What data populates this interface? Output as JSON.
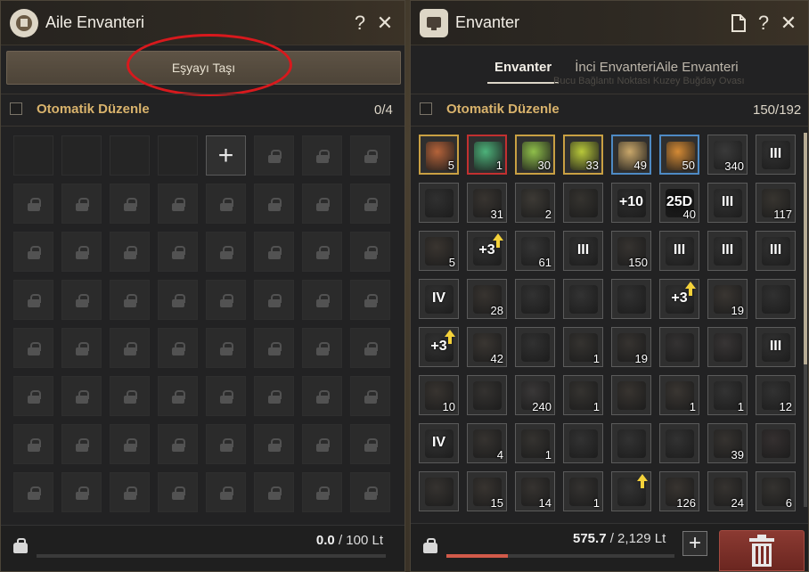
{
  "left": {
    "title": "Aile Envanteri",
    "help": "?",
    "close": "✕",
    "move_button": "Eşyayı Taşı",
    "sort_label": "Otomatik Düzenle",
    "capacity": "0/4",
    "add_slot": "+",
    "weight": "0.0",
    "weight_max": "/ 100 Lt"
  },
  "right": {
    "title": "Envanter",
    "help": "?",
    "close": "✕",
    "tabs": [
      "Envanter",
      "İnci Envanteri",
      "Aile Envanteri"
    ],
    "faint_text": "Bucu Bağlantı Noktası Kuzey Buğday Ovası",
    "sort_label": "Otomatik Düzenle",
    "capacity": "150/192",
    "weight": "575.7",
    "weight_max": "/ 2,129 Lt",
    "weight_fraction": 0.27,
    "items": [
      {
        "frame": "gold",
        "color": "#b5633a",
        "count": "5"
      },
      {
        "frame": "red",
        "color": "#4db27a",
        "count": "1"
      },
      {
        "frame": "gold",
        "color": "#8fbf4a",
        "count": "30"
      },
      {
        "frame": "gold",
        "color": "#b8c83a",
        "count": "33"
      },
      {
        "frame": "blue",
        "color": "#c9a76a",
        "count": "49"
      },
      {
        "frame": "blue",
        "color": "#d48a35",
        "count": "50"
      },
      {
        "frame": "",
        "color": "#3a3a3a",
        "count": "340"
      },
      {
        "frame": "",
        "color": "#333",
        "ench": "III"
      },
      {
        "frame": "",
        "color": "#303030"
      },
      {
        "frame": "",
        "color": "#383430",
        "count": "31"
      },
      {
        "frame": "",
        "color": "#3d3a35",
        "count": "2"
      },
      {
        "frame": "",
        "color": "#35332f"
      },
      {
        "frame": "",
        "color": "#2e2e2e",
        "ench": "+10"
      },
      {
        "frame": "",
        "color": "#111",
        "ench": "25D",
        "count": "40"
      },
      {
        "frame": "",
        "color": "#333",
        "ench": "III"
      },
      {
        "frame": "",
        "color": "#383530",
        "count": "117"
      },
      {
        "frame": "",
        "color": "#3a3530",
        "count": "5"
      },
      {
        "frame": "",
        "color": "#333",
        "ench": "+3",
        "arrow": true
      },
      {
        "frame": "",
        "color": "#353535",
        "count": "61"
      },
      {
        "frame": "",
        "color": "#333",
        "ench": "III"
      },
      {
        "frame": "",
        "color": "#363330",
        "count": "150"
      },
      {
        "frame": "",
        "color": "#333",
        "ench": "III"
      },
      {
        "frame": "",
        "color": "#333",
        "ench": "III"
      },
      {
        "frame": "",
        "color": "#333",
        "ench": "III"
      },
      {
        "frame": "",
        "color": "#333",
        "ench": "IV"
      },
      {
        "frame": "",
        "color": "#383430",
        "count": "28"
      },
      {
        "frame": "",
        "color": "#323232"
      },
      {
        "frame": "",
        "color": "#333"
      },
      {
        "frame": "",
        "color": "#313131"
      },
      {
        "frame": "",
        "color": "#333",
        "ench": "+3",
        "arrow": true
      },
      {
        "frame": "",
        "color": "#3a3632",
        "count": "19"
      },
      {
        "frame": "",
        "color": "#313131"
      },
      {
        "frame": "",
        "color": "#333",
        "ench": "+3",
        "arrow": true
      },
      {
        "frame": "",
        "color": "#3a3632",
        "count": "42"
      },
      {
        "frame": "",
        "color": "#313131"
      },
      {
        "frame": "",
        "color": "#353330",
        "count": "1"
      },
      {
        "frame": "",
        "color": "#363330",
        "count": "19"
      },
      {
        "frame": "",
        "color": "#343232"
      },
      {
        "frame": "",
        "color": "#383535"
      },
      {
        "frame": "",
        "color": "#333",
        "ench": "III"
      },
      {
        "frame": "",
        "color": "#383430",
        "count": "10"
      },
      {
        "frame": "",
        "color": "#343230"
      },
      {
        "frame": "",
        "color": "#3a3838",
        "count": "240"
      },
      {
        "frame": "",
        "color": "#353330",
        "count": "1"
      },
      {
        "frame": "",
        "color": "#383430"
      },
      {
        "frame": "",
        "color": "#3a3632",
        "count": "1"
      },
      {
        "frame": "",
        "color": "#333",
        "count": "1"
      },
      {
        "frame": "",
        "color": "#323232",
        "count": "12"
      },
      {
        "frame": "",
        "color": "#333",
        "ench": "IV"
      },
      {
        "frame": "",
        "color": "#363330",
        "count": "4"
      },
      {
        "frame": "",
        "color": "#353330",
        "count": "1"
      },
      {
        "frame": "",
        "color": "#323232"
      },
      {
        "frame": "",
        "color": "#323232"
      },
      {
        "frame": "",
        "color": "#323232"
      },
      {
        "frame": "",
        "color": "#363330",
        "count": "39"
      },
      {
        "frame": "",
        "color": "#353030"
      },
      {
        "frame": "",
        "color": "#363330"
      },
      {
        "frame": "",
        "color": "#383430",
        "count": "15"
      },
      {
        "frame": "",
        "color": "#363330",
        "count": "14"
      },
      {
        "frame": "",
        "color": "#343230",
        "count": "1"
      },
      {
        "frame": "",
        "color": "#333",
        "arrow": true
      },
      {
        "frame": "",
        "color": "#383430",
        "count": "126"
      },
      {
        "frame": "",
        "color": "#363330",
        "count": "24"
      },
      {
        "frame": "",
        "color": "#353330",
        "count": "6"
      }
    ]
  }
}
